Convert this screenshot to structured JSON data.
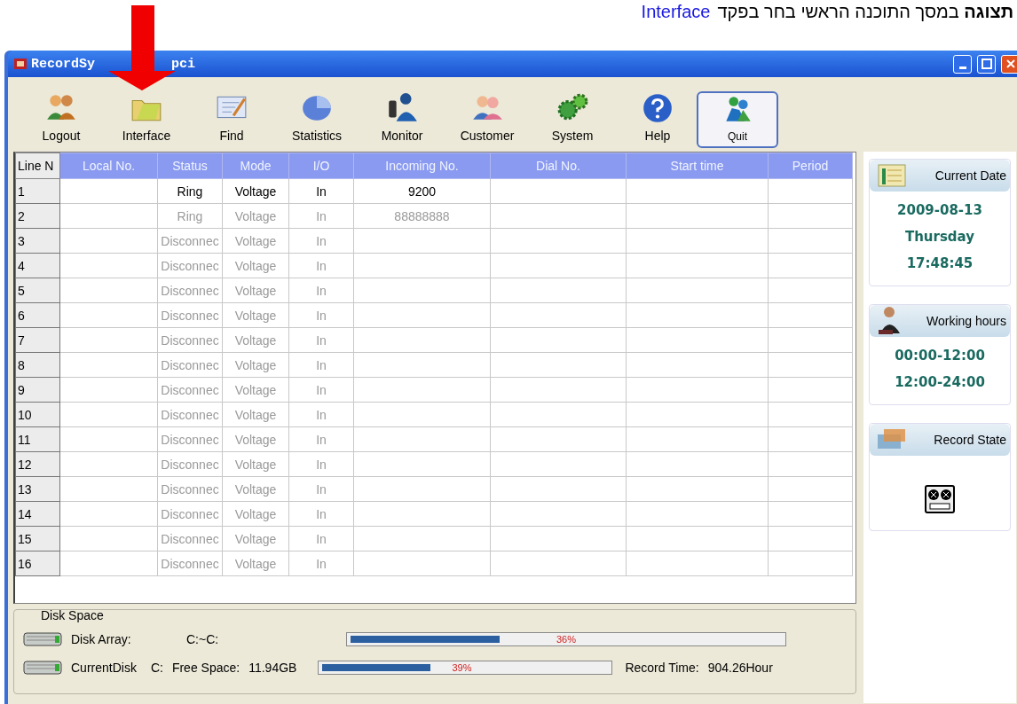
{
  "caption": {
    "text": "**תצוגה** במסך התוכנה הראשי  בחר בפקד",
    "link": "Interface"
  },
  "window": {
    "title_parts": [
      "RecordSy",
      "pci"
    ]
  },
  "toolbar": [
    {
      "label": "Logout",
      "kind": "people",
      "selected": false
    },
    {
      "label": "Interface",
      "kind": "folder",
      "selected": false
    },
    {
      "label": "Find",
      "kind": "find",
      "selected": false
    },
    {
      "label": "Statistics",
      "kind": "pie",
      "selected": false
    },
    {
      "label": "Monitor",
      "kind": "monitor",
      "selected": false
    },
    {
      "label": "Customer",
      "kind": "customer",
      "selected": false
    },
    {
      "label": "System",
      "kind": "gears",
      "selected": false
    },
    {
      "label": "Help",
      "kind": "help",
      "selected": false
    },
    {
      "label": "Quit",
      "kind": "quit",
      "selected": true
    }
  ],
  "table": {
    "columns": [
      "Line N",
      "Local No.",
      "Status",
      "Mode",
      "I/O",
      "Incoming No.",
      "Dial No.",
      "Start time",
      "Period"
    ],
    "rows": [
      {
        "line": "1",
        "status": "Ring",
        "mode": "Voltage",
        "io": "In",
        "incoming": "9200",
        "active": true
      },
      {
        "line": "2",
        "status": "Ring",
        "mode": "Voltage",
        "io": "In",
        "incoming": "88888888",
        "active": false
      },
      {
        "line": "3",
        "status": "Disconnec",
        "mode": "Voltage",
        "io": "In",
        "active": false
      },
      {
        "line": "4",
        "status": "Disconnec",
        "mode": "Voltage",
        "io": "In",
        "active": false
      },
      {
        "line": "5",
        "status": "Disconnec",
        "mode": "Voltage",
        "io": "In",
        "active": false
      },
      {
        "line": "6",
        "status": "Disconnec",
        "mode": "Voltage",
        "io": "In",
        "active": false
      },
      {
        "line": "7",
        "status": "Disconnec",
        "mode": "Voltage",
        "io": "In",
        "active": false
      },
      {
        "line": "8",
        "status": "Disconnec",
        "mode": "Voltage",
        "io": "In",
        "active": false
      },
      {
        "line": "9",
        "status": "Disconnec",
        "mode": "Voltage",
        "io": "In",
        "active": false
      },
      {
        "line": "10",
        "status": "Disconnec",
        "mode": "Voltage",
        "io": "In",
        "active": false
      },
      {
        "line": "11",
        "status": "Disconnec",
        "mode": "Voltage",
        "io": "In",
        "active": false
      },
      {
        "line": "12",
        "status": "Disconnec",
        "mode": "Voltage",
        "io": "In",
        "active": false
      },
      {
        "line": "13",
        "status": "Disconnec",
        "mode": "Voltage",
        "io": "In",
        "active": false
      },
      {
        "line": "14",
        "status": "Disconnec",
        "mode": "Voltage",
        "io": "In",
        "active": false
      },
      {
        "line": "15",
        "status": "Disconnec",
        "mode": "Voltage",
        "io": "In",
        "active": false
      },
      {
        "line": "16",
        "status": "Disconnec",
        "mode": "Voltage",
        "io": "In",
        "active": false
      }
    ]
  },
  "disk_space": {
    "title": "Disk Space",
    "disk_array": {
      "label": "Disk Array:",
      "path": "C:~C:",
      "level": 0.35,
      "percent": "36%"
    },
    "current_disk": {
      "label": "CurrentDisk",
      "drive": "C:",
      "free_label": "Free Space:",
      "free": "11.94GB",
      "level": 0.38,
      "percent": "39%",
      "record_label": "Record Time:",
      "record": "904.26Hour"
    }
  },
  "side_panel": {
    "current_date": {
      "title": "Current Date",
      "lines": [
        "2009-08-13",
        "Thursday",
        "17:48:45"
      ]
    },
    "working_hours": {
      "title": "Working hours",
      "lines": [
        "00:00-12:00",
        "12:00-24:00"
      ]
    },
    "record_state": {
      "title": "Record State"
    }
  }
}
